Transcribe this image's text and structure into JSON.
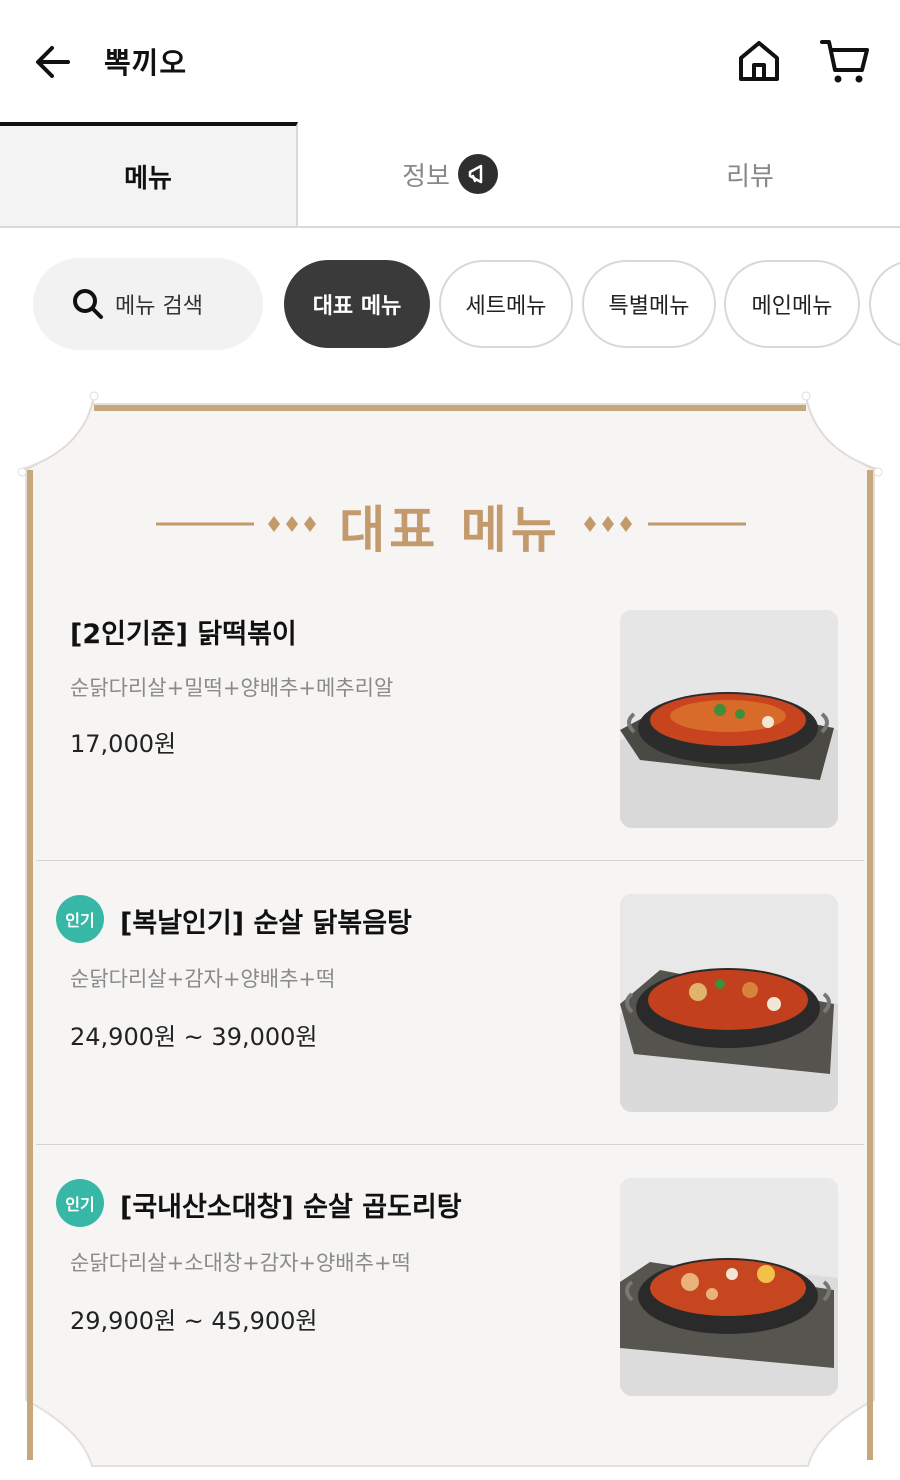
{
  "header": {
    "title": "뽁끼오",
    "back_icon": "arrow-left-icon",
    "home_icon": "home-icon",
    "cart_icon": "cart-icon"
  },
  "tabs": [
    {
      "label": "메뉴",
      "active": true
    },
    {
      "label": "정보",
      "active": false,
      "icon": "megaphone-icon"
    },
    {
      "label": "리뷰",
      "active": false
    }
  ],
  "search": {
    "label": "메뉴 검색",
    "icon": "search-icon"
  },
  "chips": [
    {
      "label": "대표 메뉴",
      "active": true
    },
    {
      "label": "세트메뉴",
      "active": false
    },
    {
      "label": "특별메뉴",
      "active": false
    },
    {
      "label": "메인메뉴",
      "active": false
    }
  ],
  "section": {
    "title": "대표 메뉴"
  },
  "items": [
    {
      "badge": "",
      "name": "[2인기준] 닭떡볶이",
      "desc": "순닭다리살+밀떡+양배추+메추리알",
      "price": "17,000원"
    },
    {
      "badge": "인기",
      "name": "[복날인기] 순살 닭볶음탕",
      "desc": "순닭다리살+감자+양배추+떡",
      "price": "24,900원 ~ 39,000원"
    },
    {
      "badge": "인기",
      "name": "[국내산소대창] 순살 곱도리탕",
      "desc": "순닭다리살+소대창+감자+양배추+떡",
      "price": "29,900원 ~ 45,900원"
    }
  ],
  "colors": {
    "accent": "#c39a6c",
    "badge": "#37b7a6",
    "active_chip": "#3a3a3a",
    "frame": "#c9a77d"
  }
}
